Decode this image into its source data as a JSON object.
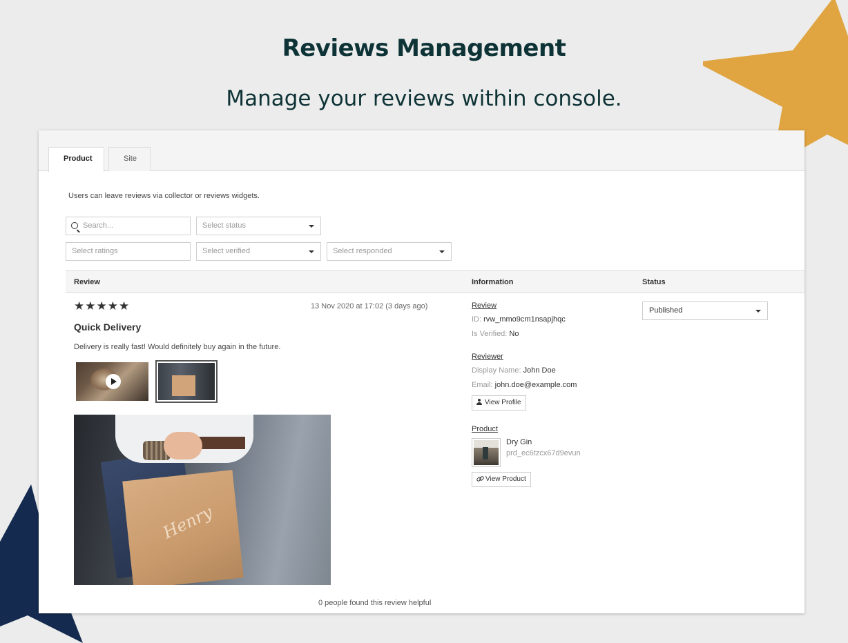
{
  "hero": {
    "title": "Reviews Management",
    "subtitle": "Manage your reviews within console."
  },
  "colors": {
    "gold_star": "#e0a441",
    "navy_star": "#142a4f",
    "heading": "#0e3336"
  },
  "tabs": [
    {
      "label": "Product",
      "active": true
    },
    {
      "label": "Site",
      "active": false
    }
  ],
  "hint": "Users can leave reviews via collector or reviews widgets.",
  "filters": {
    "search_placeholder": "Search...",
    "status_placeholder": "Select status",
    "ratings_placeholder": "Select ratings",
    "verified_placeholder": "Select verified",
    "responded_placeholder": "Select responded"
  },
  "table": {
    "headers": {
      "review": "Review",
      "information": "Information",
      "status": "Status"
    }
  },
  "review": {
    "rating": 5,
    "stars": "★★★★★",
    "date": "13 Nov 2020 at 17:02 (3 days ago)",
    "title": "Quick Delivery",
    "body": "Delivery is really fast! Would definitely buy again in the future.",
    "helpful": "0 people found this review helpful",
    "status": "Published"
  },
  "information": {
    "review_heading": "Review",
    "id_label": "ID:",
    "id_value": "rvw_mmo9cm1nsapjhqc",
    "verified_label": "Is Verified:",
    "verified_value": "No",
    "reviewer_heading": "Reviewer",
    "display_name_label": "Display Name:",
    "display_name_value": "John Doe",
    "email_label": "Email:",
    "email_value": "john.doe@example.com",
    "view_profile": "View Profile",
    "product_heading": "Product",
    "product_name": "Dry Gin",
    "product_id": "prd_ec6tzcx67d9evun",
    "view_product": "View Product"
  }
}
